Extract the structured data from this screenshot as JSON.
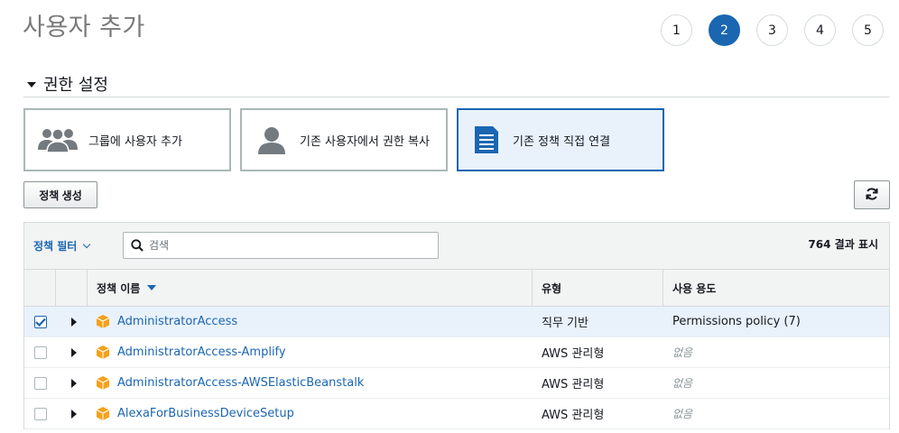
{
  "page": {
    "title": "사용자 추가"
  },
  "steps": [
    "1",
    "2",
    "3",
    "4",
    "5"
  ],
  "active_step": "2",
  "section": {
    "title": "권한 설정"
  },
  "options": [
    {
      "label": "그룹에 사용자 추가",
      "icon": "group-icon"
    },
    {
      "label": "기존 사용자에서 권한 복사",
      "icon": "user-icon"
    },
    {
      "label": "기존 정책 직접 연결",
      "icon": "document-icon"
    }
  ],
  "selected_option": "기존 정책 직접 연결",
  "toolbar": {
    "create_policy_label": "정책 생성",
    "refresh_icon": "refresh-icon"
  },
  "table": {
    "filter_label": "정책 필터",
    "search_placeholder": "검색",
    "result_count": "764 결과 표시",
    "columns": {
      "name": "정책 이름",
      "type": "유형",
      "usage": "사용 용도"
    },
    "rows": [
      {
        "name": "AdministratorAccess",
        "type": "직무 기반",
        "usage": "Permissions policy (7)",
        "checked": true
      },
      {
        "name": "AdministratorAccess-Amplify",
        "type": "AWS 관리형",
        "usage": "없음",
        "checked": false
      },
      {
        "name": "AdministratorAccess-AWSElasticBeanstalk",
        "type": "AWS 관리형",
        "usage": "없음",
        "checked": false
      },
      {
        "name": "AlexaForBusinessDeviceSetup",
        "type": "AWS 관리형",
        "usage": "없음",
        "checked": false
      }
    ]
  },
  "colors": {
    "accent": "#1b66b1",
    "policy_icon": "#f5a21b",
    "selected_bg": "#e9f2fb"
  }
}
